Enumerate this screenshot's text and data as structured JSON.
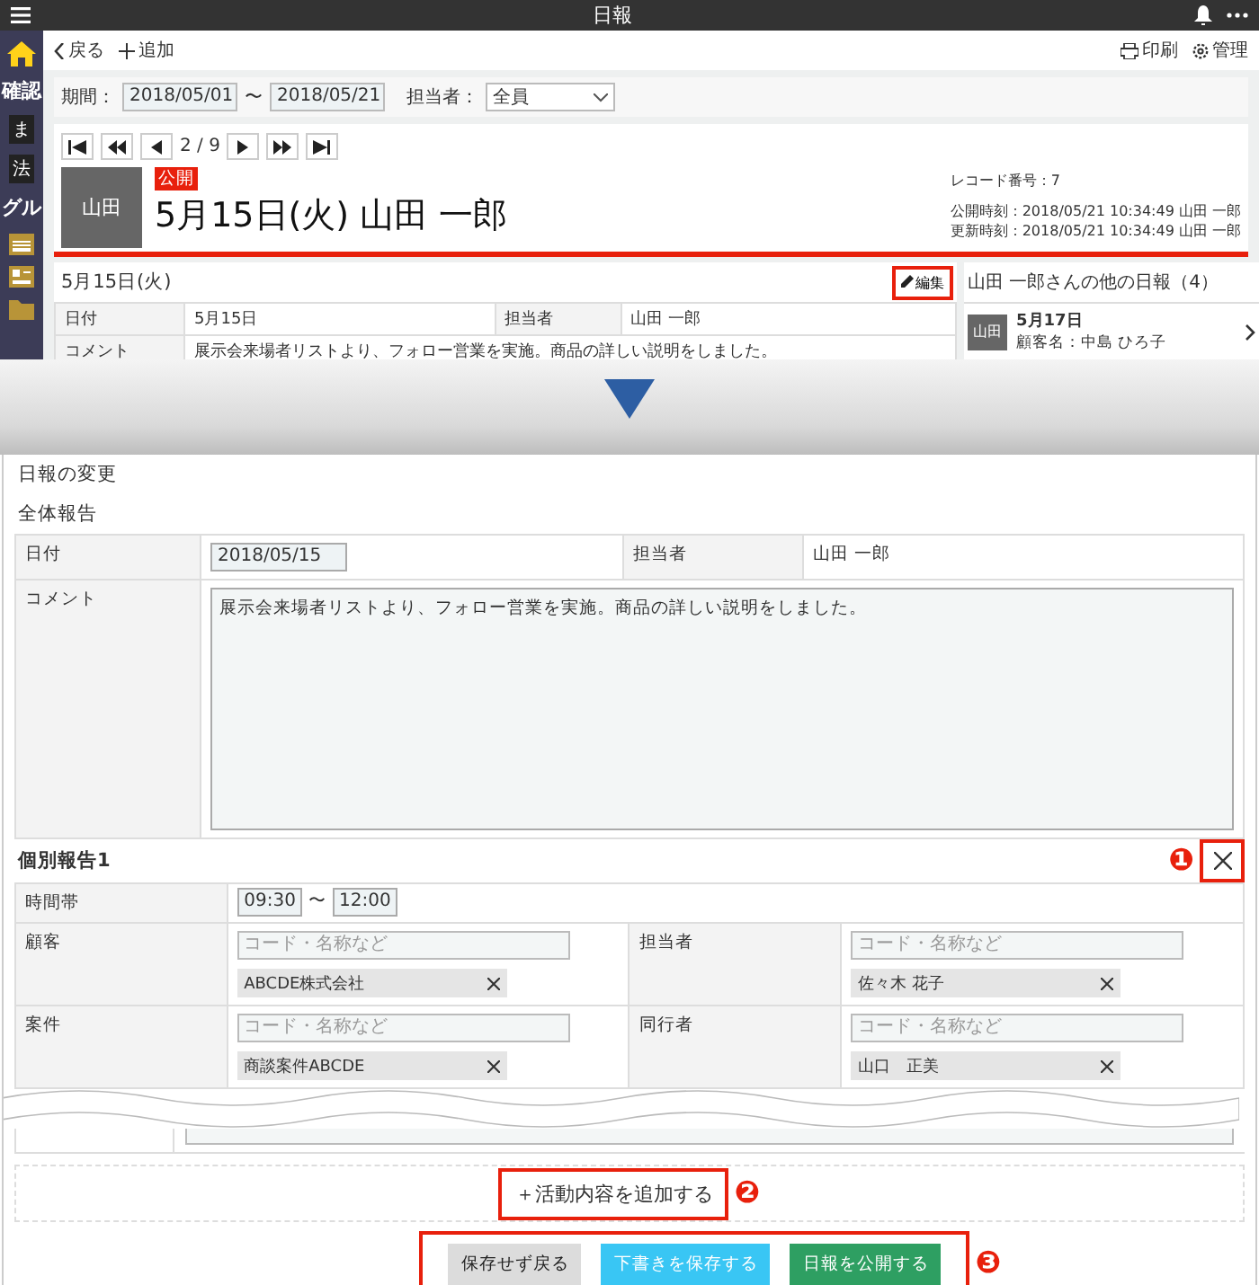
{
  "header": {
    "title": "日報"
  },
  "sidebar": {
    "items": [
      {
        "kind": "icon",
        "selected": true
      },
      {
        "kind": "text",
        "label": "確認",
        "selected": false
      },
      {
        "kind": "text",
        "label": "ま",
        "selected": false
      },
      {
        "kind": "text",
        "label": "法",
        "selected": false
      },
      {
        "kind": "text",
        "label": "グル",
        "selected": false
      },
      {
        "kind": "icon",
        "selected": false
      },
      {
        "kind": "icon",
        "selected": false
      },
      {
        "kind": "icon",
        "selected": false
      }
    ]
  },
  "toolbar": {
    "back": "戻る",
    "add": "追加",
    "print": "印刷",
    "manage": "管理"
  },
  "filter": {
    "period_label": "期間：",
    "from": "2018/05/01",
    "separator": "〜",
    "to": "2018/05/21",
    "assignee_label": "担当者：",
    "assignee": "全員"
  },
  "pager": {
    "position": "2 / 9"
  },
  "record": {
    "avatar": "山田",
    "status": "公開",
    "title": "5月15日(火) 山田 一郎",
    "record_number": "レコード番号：7",
    "published": "公開時刻：2018/05/21 10:34:49 山田 一郎",
    "updated": "更新時刻：2018/05/21 10:34:49 山田 一郎"
  },
  "detail": {
    "heading": "5月15日(火)",
    "edit": "編集",
    "date_label": "日付",
    "date": "5月15日",
    "assignee_label": "担当者",
    "assignee": "山田 一郎",
    "comment_label": "コメント",
    "comment": "展示会来場者リストより、フォロー営業を実施。商品の詳しい説明をしました。"
  },
  "others": {
    "title": "山田 一郎さんの他の日報（4）",
    "items": [
      {
        "avatar": "山田",
        "date": "5月17日",
        "customer": "顧客名：中島 ひろ子"
      }
    ]
  },
  "edit_form": {
    "title": "日報の変更",
    "section": "全体報告",
    "date_label": "日付",
    "date": "2018/05/15",
    "assignee_label": "担当者",
    "assignee": "山田 一郎",
    "comment_label": "コメント",
    "comment": "展示会来場者リストより、フォロー営業を実施。商品の詳しい説明をしました。"
  },
  "activity": {
    "title": "個別報告1",
    "callout": "❶",
    "time_label": "時間帯",
    "start": "09:30",
    "separator": "〜",
    "end": "12:00",
    "lookups": [
      {
        "label": "顧客",
        "placeholder": "コード・名称など",
        "chip": "ABCDE株式会社"
      },
      {
        "label": "担当者",
        "placeholder": "コード・名称など",
        "chip": "佐々木 花子"
      },
      {
        "label": "案件",
        "placeholder": "コード・名称など",
        "chip": "商談案件ABCDE"
      },
      {
        "label": "同行者",
        "placeholder": "コード・名称など",
        "chip": "山口　正美"
      }
    ]
  },
  "add_activity": {
    "label": "＋活動内容を追加する",
    "callout": "❷"
  },
  "actions": {
    "callout": "❸",
    "buttons": [
      {
        "label": "保存せず戻る",
        "kind": "cancel"
      },
      {
        "label": "下書きを保存する",
        "kind": "draft"
      },
      {
        "label": "日報を公開する",
        "kind": "publish"
      }
    ]
  }
}
